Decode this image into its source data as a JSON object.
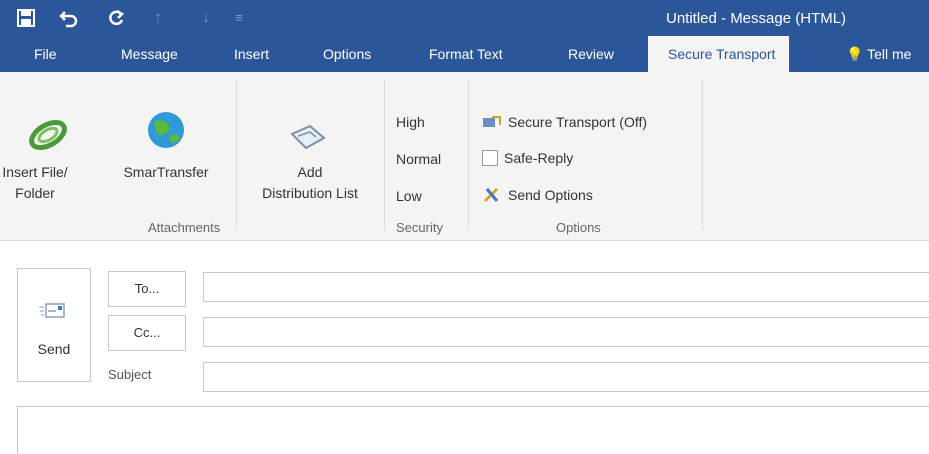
{
  "window": {
    "title": "Untitled - Message (HTML)"
  },
  "qat": {
    "save_icon": "save-icon",
    "undo_icon": "undo-icon",
    "redo_icon": "redo-icon"
  },
  "tabs": [
    {
      "label": "File"
    },
    {
      "label": "Message"
    },
    {
      "label": "Insert"
    },
    {
      "label": "Options"
    },
    {
      "label": "Format Text"
    },
    {
      "label": "Review"
    },
    {
      "label": "Secure Transport",
      "active": true
    },
    {
      "label": "Tell me"
    }
  ],
  "ribbon": {
    "insert_file": {
      "line1": "Insert File/",
      "line2": "Folder"
    },
    "smartransfer": {
      "label": "SmarTransfer"
    },
    "add_dist": {
      "line1": "Add",
      "line2": "Distribution List"
    },
    "attachments_group": "Attachments",
    "security": {
      "high": "High",
      "normal": "Normal",
      "low": "Low",
      "group": "Security"
    },
    "options": {
      "secure_transport": "Secure Transport (Off)",
      "safe_reply": "Safe-Reply",
      "send_options": "Send Options",
      "group": "Options"
    }
  },
  "compose": {
    "send": "Send",
    "to": "To...",
    "cc": "Cc...",
    "subject": "Subject"
  }
}
